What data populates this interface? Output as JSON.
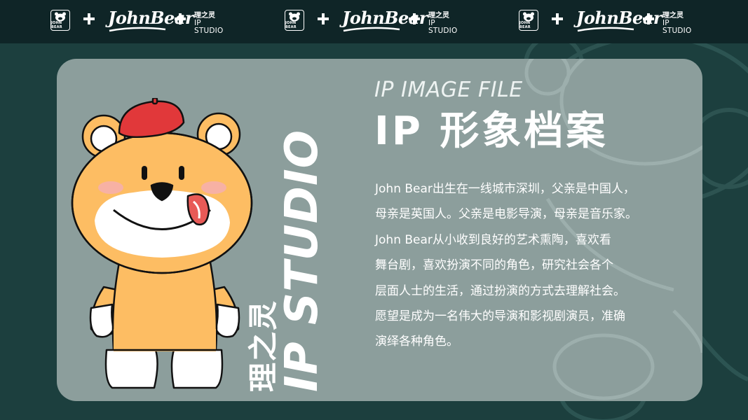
{
  "topbar": {
    "badge_text": "JOHN BEAR",
    "script_logo": "JohnBear",
    "studio_cn": "理之灵",
    "studio_en": "IP STUDIO",
    "repeat_count": 3
  },
  "card": {
    "subtitle_en": "IP IMAGE FILE",
    "title_cn": "IP 形象档案",
    "vertical_cn": "理之灵",
    "vertical_en": "IP STUDIO",
    "description_lines": [
      "John Bear出生在一线城市深圳，父亲是中国人，",
      "母亲是英国人。父亲是电影导演，母亲是音乐家。",
      "John Bear从小收到良好的艺术熏陶，喜欢看",
      "舞台剧，喜欢扮演不同的角色，研究社会各个",
      "层面人士的生活，通过扮演的方式去理解社会。",
      "愿望是成为一名伟大的导演和影视剧演员，准确",
      "演绎各种角色。"
    ]
  },
  "colors": {
    "background": "#1c3f3e",
    "topbar": "#0f2527",
    "card": "#8c9e9c",
    "bear_fur": "#fdbd63",
    "bear_face": "#ffffff",
    "beret": "#e1383a",
    "cheek": "#f7b1a4",
    "tongue": "#e85a57",
    "text": "#ffffff"
  },
  "icons": [
    "bear-badge-icon",
    "plus-icon",
    "bear-mascot-illustration",
    "beret-icon"
  ]
}
